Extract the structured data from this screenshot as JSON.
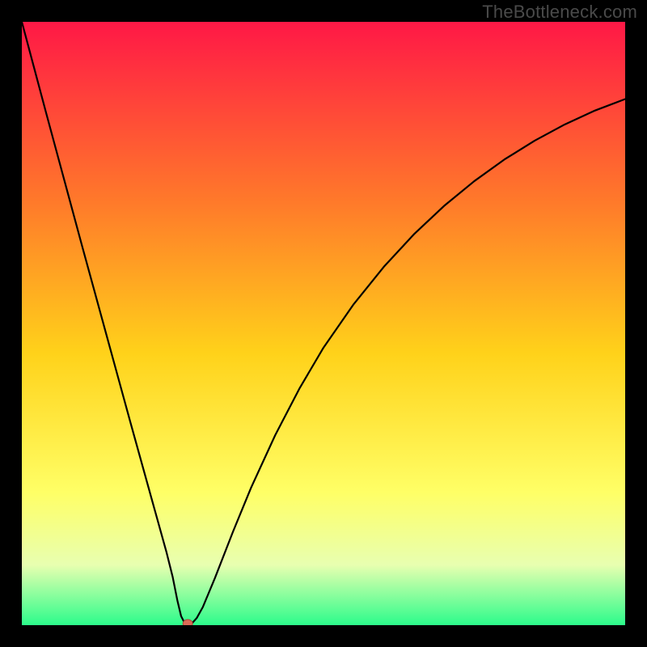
{
  "watermark": "TheBottleneck.com",
  "colors": {
    "frame_bg": "#000000",
    "curve": "#000000",
    "marker_fill": "#da6a56",
    "marker_stroke": "#a84a3a",
    "grad_top": "#ff1846",
    "grad_mid1": "#ff7a2a",
    "grad_mid2": "#ffd21a",
    "grad_mid3": "#ffff66",
    "grad_mid4": "#e8ffb0",
    "grad_bottom": "#2cfc8b"
  },
  "chart_data": {
    "type": "line",
    "title": "",
    "xlabel": "",
    "ylabel": "",
    "xlim": [
      0,
      100
    ],
    "ylim": [
      0,
      100
    ],
    "notch": {
      "x": 27.5,
      "y": 0
    },
    "series": [
      {
        "name": "bottleneck-curve",
        "points": [
          [
            0.0,
            100.0
          ],
          [
            2.0,
            92.5
          ],
          [
            4.0,
            85.0
          ],
          [
            6.0,
            77.6
          ],
          [
            8.0,
            70.2
          ],
          [
            10.0,
            62.8
          ],
          [
            12.0,
            55.5
          ],
          [
            14.0,
            48.2
          ],
          [
            16.0,
            40.9
          ],
          [
            18.0,
            33.6
          ],
          [
            20.0,
            26.4
          ],
          [
            22.0,
            19.2
          ],
          [
            24.0,
            12.0
          ],
          [
            25.0,
            8.0
          ],
          [
            25.8,
            4.0
          ],
          [
            26.4,
            1.5
          ],
          [
            27.0,
            0.3
          ],
          [
            27.5,
            0.0
          ],
          [
            28.2,
            0.3
          ],
          [
            29.0,
            1.2
          ],
          [
            30.0,
            3.0
          ],
          [
            32.0,
            7.8
          ],
          [
            35.0,
            15.5
          ],
          [
            38.0,
            22.8
          ],
          [
            42.0,
            31.5
          ],
          [
            46.0,
            39.2
          ],
          [
            50.0,
            46.0
          ],
          [
            55.0,
            53.2
          ],
          [
            60.0,
            59.4
          ],
          [
            65.0,
            64.8
          ],
          [
            70.0,
            69.5
          ],
          [
            75.0,
            73.6
          ],
          [
            80.0,
            77.2
          ],
          [
            85.0,
            80.3
          ],
          [
            90.0,
            83.0
          ],
          [
            95.0,
            85.3
          ],
          [
            100.0,
            87.2
          ]
        ]
      }
    ],
    "background_gradient_stops": [
      [
        0,
        "#ff1846"
      ],
      [
        30,
        "#ff7a2a"
      ],
      [
        55,
        "#ffd21a"
      ],
      [
        78,
        "#ffff66"
      ],
      [
        90,
        "#e8ffb0"
      ],
      [
        100,
        "#2cfc8b"
      ]
    ]
  }
}
